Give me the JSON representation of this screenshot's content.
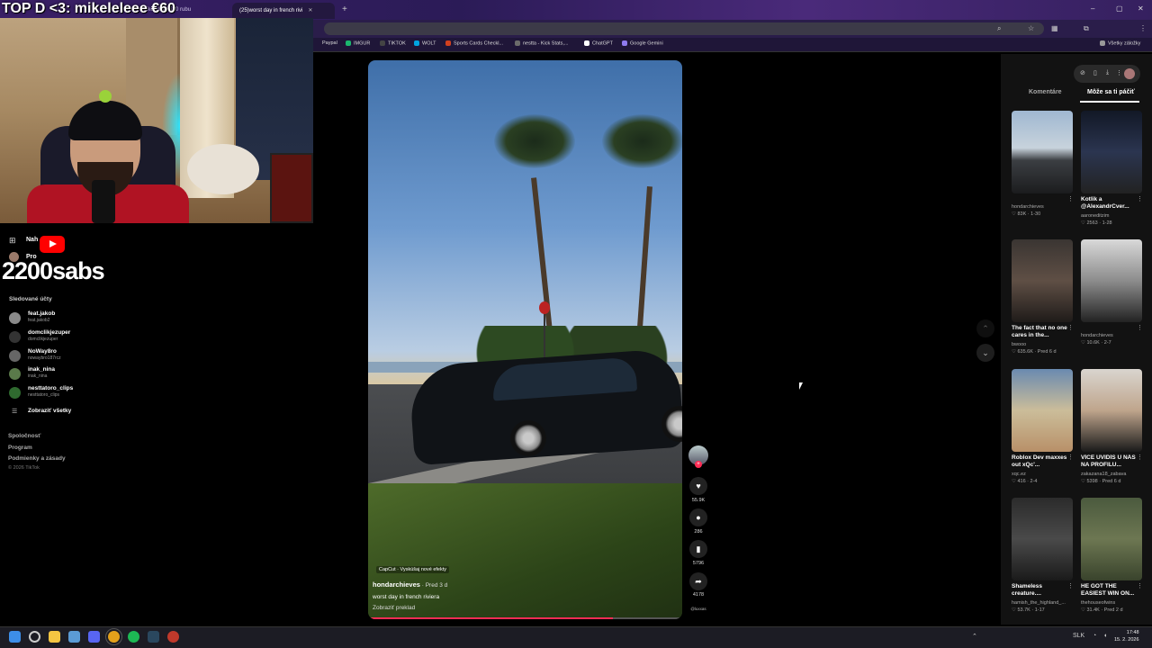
{
  "overlay": {
    "title": "TOP D <3: mikeleleee €60",
    "subs": "2200sabs"
  },
  "browser": {
    "tabs": [
      {
        "label": "mikeleleee €60 rubu"
      },
      {
        "label": "(25)worst day in french rivi"
      }
    ],
    "new_tab": "+",
    "window_controls": [
      "–",
      "▢",
      "✕"
    ],
    "bookmarks": [
      {
        "label": "Paypal",
        "color": "#2a6cd6"
      },
      {
        "label": "IMGUR",
        "color": "#1bb76e"
      },
      {
        "label": "TIKTOK",
        "color": "#222222"
      },
      {
        "label": "WOLT",
        "color": "#00a4e0"
      },
      {
        "label": "Sports Cards Checkl...",
        "color": "#d2401e"
      },
      {
        "label": "nestta - Kick Stats,...",
        "color": "#6b6b6b"
      },
      {
        "label": "ChatGPT",
        "color": "#ffffff"
      },
      {
        "label": "Google Gemini",
        "color": "#8f7bf0"
      }
    ],
    "all_bookmarks": "Všetky záložky"
  },
  "sidebar": {
    "items_partial": [
      {
        "label": "Nah",
        "icon": "plus-square-icon"
      },
      {
        "label": "Pro",
        "icon": "profile-avatar-icon"
      }
    ],
    "following_title": "Sledované účty",
    "accounts": [
      {
        "name": "feat.jakob",
        "handle": "feat.jakob2",
        "color": "#8a8a8a"
      },
      {
        "name": "domclikjezuper",
        "handle": "domclikjezuper",
        "color": "#333333"
      },
      {
        "name": "NoWay8ro",
        "handle": "nowaybro187rcz",
        "color": "#666666"
      },
      {
        "name": "inak_nina",
        "handle": "inak_nina",
        "color": "#5a7a4a"
      },
      {
        "name": "nesttatoro_clips",
        "handle": "nesttatoro_clips",
        "color": "#2f6a2f"
      }
    ],
    "show_all": "Zobraziť všetky",
    "footer": [
      "Spoločnosť",
      "Program",
      "Podmienky a zásady"
    ],
    "copyright": "© 2026 TikTok"
  },
  "video": {
    "capcut": "CapCut · Vyskúšaj nové efekty",
    "author": "hondarchieves",
    "ago": " · Pred 3 d",
    "description": "worst day in french riviera",
    "translate": "Zobraziť preklad",
    "progress": 0.78
  },
  "actions": {
    "likes": "55.9K",
    "comments": "286",
    "saves": "5796",
    "shares": "4178",
    "music": "@luxxas"
  },
  "right_panel": {
    "tabs": [
      "Komentáre",
      "Môže sa ti páčiť"
    ],
    "active_tab": 1,
    "cards": [
      {
        "title": "",
        "author": "hondarchieves",
        "stats": "♡ 83K · 1-30",
        "thumb": "car"
      },
      {
        "title": "Kotlik a @AlexandrCver...",
        "author": "aaroneditzim",
        "stats": "♡ 2563 · 1-28",
        "thumb": "studio"
      },
      {
        "title": "The fact that no one cares in the...",
        "author": "bwooo",
        "stats": "♡ 635.6K · Pred 6 d",
        "thumb": "dash"
      },
      {
        "title": "",
        "author": "hondarchieves",
        "stats": "♡ 10.6K · 2-7",
        "thumb": "garage"
      },
      {
        "title": "Roblox Dev maxxes out xQc'...",
        "author": "xqc.ez",
        "stats": "♡ 416 · 2-4",
        "thumb": "stream"
      },
      {
        "title": "VÍCE UVIDÍŠ U NÁS NA PROFILU...",
        "author": "zakazana18_zabava",
        "stats": "♡ 5398 · Pred 6 d",
        "thumb": "man"
      },
      {
        "title": "Shameless creature....",
        "author": "hamish_the_highland_...",
        "stats": "♡ 53.7K · 1-17",
        "thumb": "dark"
      },
      {
        "title": "HE GOT THE EASIEST WIN ON...",
        "author": "thehouseofwins",
        "stats": "♡ 31.4K · Pred 2 d",
        "thumb": "map"
      }
    ]
  },
  "taskbar": {
    "lang": "SLK",
    "time": "17:48",
    "date": "15. 2. 2026",
    "apps": [
      {
        "name": "start",
        "color": "#3d8ee8"
      },
      {
        "name": "search",
        "color": "#cccccc"
      },
      {
        "name": "explorer",
        "color": "#f4c542"
      },
      {
        "name": "app",
        "color": "#5b9bd5"
      },
      {
        "name": "discord",
        "color": "#5865f2"
      },
      {
        "name": "chrome",
        "color": "#e4a11b"
      },
      {
        "name": "spotify",
        "color": "#1db954"
      },
      {
        "name": "steam",
        "color": "#2a475e"
      },
      {
        "name": "obs",
        "color": "#c0392b"
      }
    ]
  }
}
